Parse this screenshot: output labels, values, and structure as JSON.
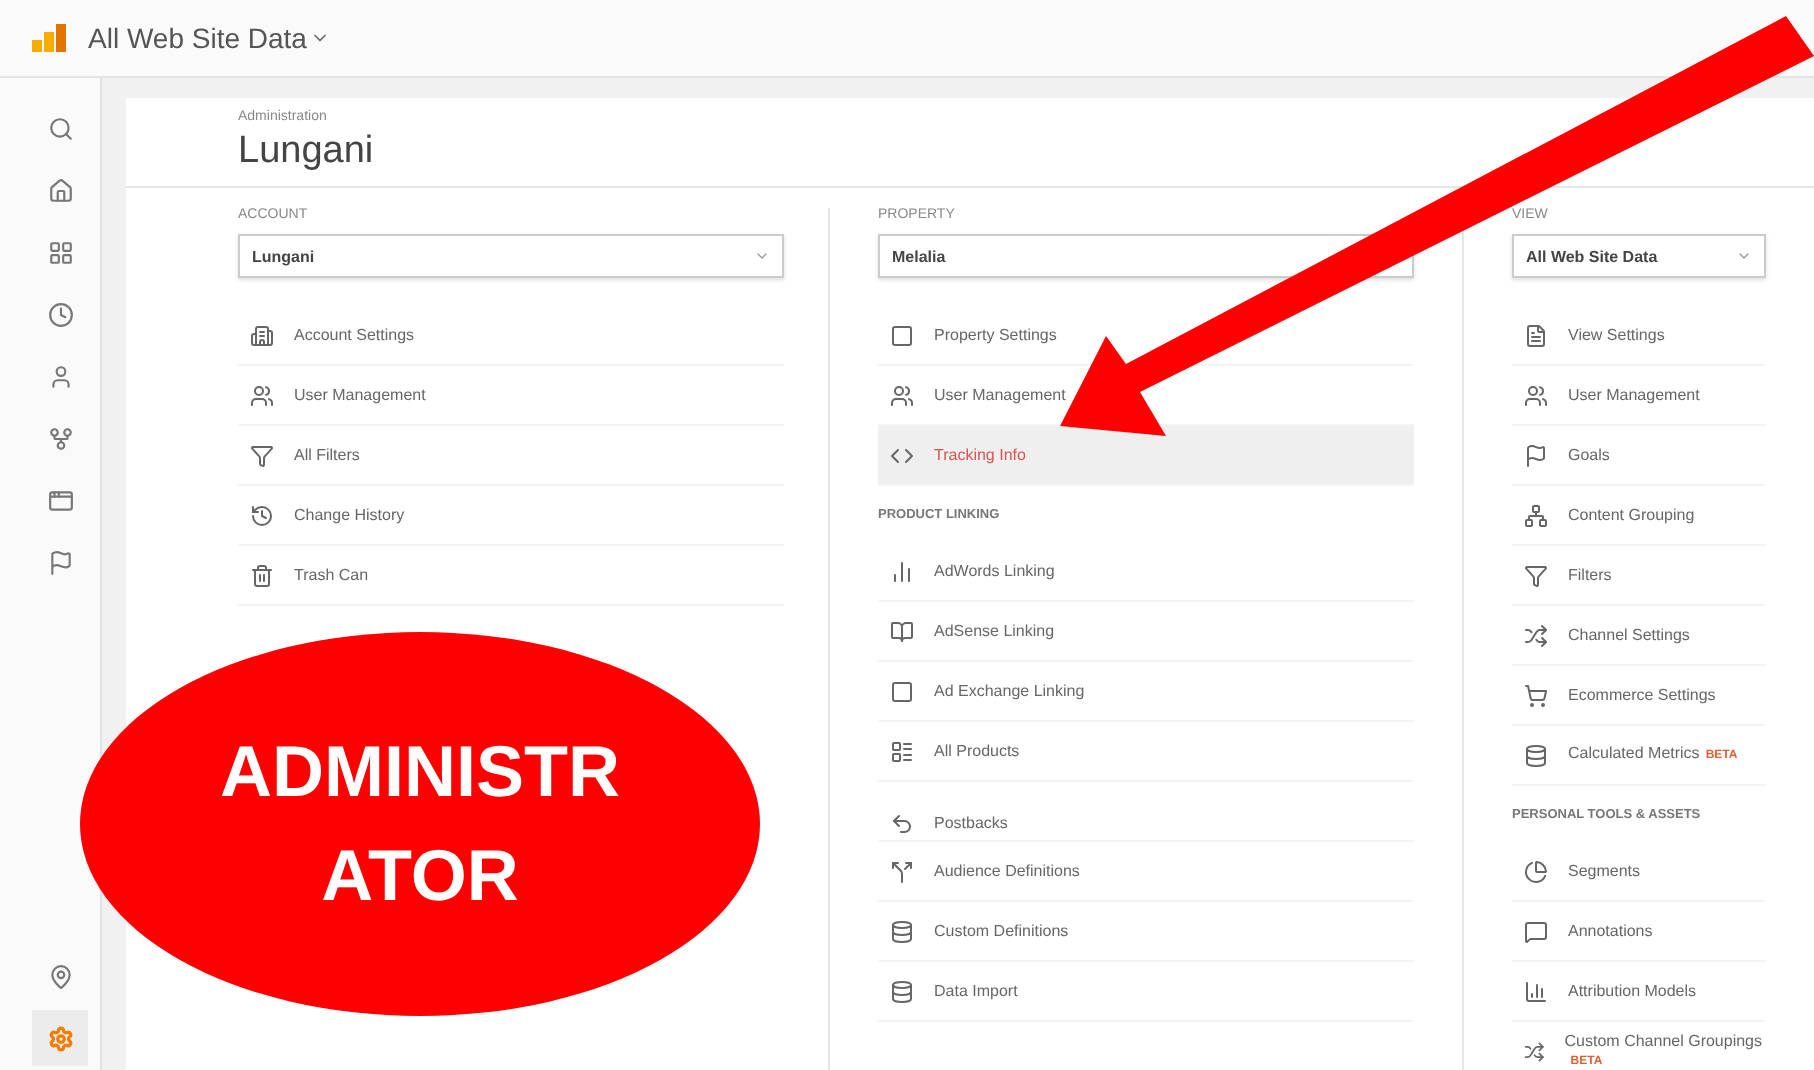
{
  "top_bar": {
    "title": "All Web Site Data"
  },
  "sidebar": {
    "items": [
      {
        "kind": "search",
        "selected": false
      },
      {
        "kind": "home",
        "selected": false
      },
      {
        "kind": "dashboard",
        "selected": false
      },
      {
        "kind": "clock",
        "selected": false
      },
      {
        "kind": "person",
        "selected": false
      },
      {
        "kind": "acquisition",
        "selected": false
      },
      {
        "kind": "window",
        "selected": false
      },
      {
        "kind": "flag",
        "selected": false
      }
    ],
    "bottom_items": [
      {
        "kind": "pin",
        "selected": false
      },
      {
        "kind": "gear",
        "selected": true
      }
    ]
  },
  "header": {
    "label": "Administration",
    "title": "Lungani"
  },
  "columns": [
    {
      "label": "ACCOUNT",
      "value": "Lungani",
      "rows": [
        {
          "kind": "building",
          "label": "Account Settings",
          "selected": false
        },
        {
          "kind": "users",
          "label": "User Management",
          "selected": false
        },
        {
          "kind": "filter",
          "label": "All Filters",
          "selected": false
        },
        {
          "kind": "history",
          "label": "Change History",
          "selected": false
        },
        {
          "kind": "trash",
          "label": "Trash Can",
          "selected": false
        }
      ]
    },
    {
      "label": "PROPERTY",
      "value": "Melalia",
      "rows": [
        {
          "kind": "square",
          "label": "Property Settings",
          "selected": false
        },
        {
          "kind": "users",
          "label": "User Management",
          "selected": false
        },
        {
          "kind": "code",
          "label": "Tracking Info",
          "selected": true
        },
        {
          "kind": "section",
          "label": "PRODUCT LINKING"
        },
        {
          "kind": "bars",
          "label": "AdWords Linking",
          "selected": false
        },
        {
          "kind": "book",
          "label": "AdSense Linking",
          "selected": false
        },
        {
          "kind": "square",
          "label": "Ad Exchange Linking",
          "selected": false
        },
        {
          "kind": "grid",
          "label": "All Products",
          "selected": false
        },
        {
          "kind": "undo",
          "label": "Postbacks",
          "selected": false,
          "spaced": true
        },
        {
          "kind": "split",
          "label": "Audience Definitions",
          "selected": false
        },
        {
          "kind": "database",
          "label": "Custom Definitions",
          "selected": false
        },
        {
          "kind": "database",
          "label": "Data Import",
          "selected": false
        }
      ]
    },
    {
      "label": "VIEW",
      "value": "All Web Site Data",
      "rows": [
        {
          "kind": "file",
          "label": "View Settings",
          "selected": false
        },
        {
          "kind": "users",
          "label": "User Management",
          "selected": false
        },
        {
          "kind": "flag",
          "label": "Goals",
          "selected": false
        },
        {
          "kind": "tree",
          "label": "Content Grouping",
          "selected": false
        },
        {
          "kind": "filter",
          "label": "Filters",
          "selected": false
        },
        {
          "kind": "channel",
          "label": "Channel Settings",
          "selected": false
        },
        {
          "kind": "cart",
          "label": "Ecommerce Settings",
          "selected": false
        },
        {
          "kind": "database",
          "label": "Calculated Metrics",
          "badge": "BETA",
          "selected": false
        },
        {
          "kind": "section",
          "label": "PERSONAL TOOLS & ASSETS"
        },
        {
          "kind": "segments",
          "label": "Segments",
          "selected": false
        },
        {
          "kind": "message",
          "label": "Annotations",
          "selected": false
        },
        {
          "kind": "chart",
          "label": "Attribution Models",
          "selected": false
        },
        {
          "kind": "channel",
          "label": "Custom Channel Groupings",
          "badge": "BETA",
          "selected": false
        }
      ]
    }
  ],
  "callout": {
    "text": "ADMINISTR ATOR"
  }
}
